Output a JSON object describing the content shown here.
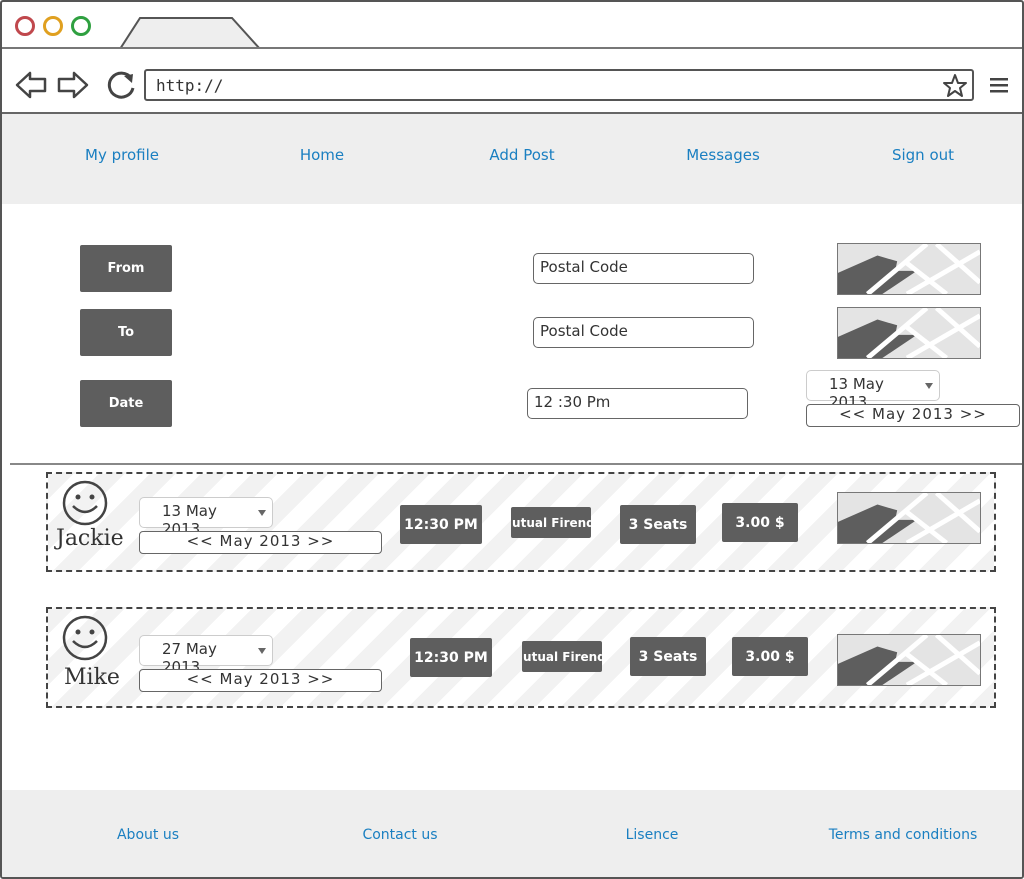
{
  "browser": {
    "url": "http://",
    "colors": {
      "close": "#c0484d",
      "minimize": "#e0a020",
      "maximize": "#2fa040"
    },
    "icons": [
      "back-arrow-icon",
      "forward-arrow-icon",
      "reload-icon",
      "star-icon",
      "hamburger-menu-icon"
    ]
  },
  "nav": {
    "items": [
      "My profile",
      "Home",
      "Add Post",
      "Messages",
      "Sign out"
    ],
    "link_color": "#1a7fc1"
  },
  "form": {
    "from_label": "From",
    "to_label": "To",
    "date_label": "Date",
    "from_postal_placeholder": "Postal Code",
    "to_postal_placeholder": "Postal Code",
    "time_value": "12 :30 Pm",
    "date_select": "13 May 2013",
    "month_nav": "<< May 2013 >>"
  },
  "rides": [
    {
      "name": "Jackie",
      "date": "13 May 2013",
      "month_nav": "<< May 2013 >>",
      "time": "12:30 PM",
      "mutual": "Mutual Firends",
      "seats": "3 Seats",
      "price": "3.00 $"
    },
    {
      "name": "Mike",
      "date": "27 May 2013",
      "month_nav": "<< May 2013 >>",
      "time": "12:30 PM",
      "mutual": "Mutual Firends",
      "seats": "3 Seats",
      "price": "3.00 $"
    }
  ],
  "footer": {
    "links": [
      "About us",
      "Contact us",
      "Lisence",
      "Terms and conditions"
    ]
  }
}
